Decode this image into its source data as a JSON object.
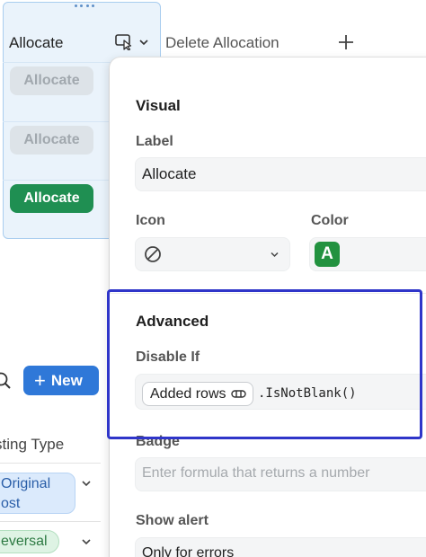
{
  "column": {
    "header_label": "Allocate",
    "header_icon": "cursor-select-icon",
    "delete_label": "Delete Allocation",
    "rows": [
      {
        "label": "Allocate",
        "state": "disabled"
      },
      {
        "label": "Allocate",
        "state": "disabled"
      },
      {
        "label": "Allocate",
        "state": "enabled"
      }
    ]
  },
  "left_table": {
    "new_button_label": "New",
    "column_header": "sting Type",
    "tags": [
      {
        "label": "riginal ost",
        "line1": "Original",
        "line2": "ost",
        "color": "#dbeafc"
      },
      {
        "label": "eversal",
        "color": "#def3e4"
      }
    ]
  },
  "panel": {
    "visual": {
      "title": "Visual",
      "label_label": "Label",
      "label_value": "Allocate",
      "icon_label": "Icon",
      "icon_value": "block-icon",
      "color_label": "Color",
      "color_swatch_text": "A",
      "color_value": "#22923f"
    },
    "advanced": {
      "title": "Advanced",
      "disable_if_label": "Disable If",
      "formula_chip": "Added rows",
      "formula_rest": ".IsNotBlank()"
    },
    "badge": {
      "label": "Badge",
      "placeholder": "Enter formula that returns a number"
    },
    "show_alert": {
      "label": "Show alert",
      "value": "Only for errors"
    }
  },
  "colors": {
    "accent_blue": "#2f78d8",
    "highlight_border": "#2f35c9",
    "allocate_green": "#1f8f52"
  }
}
